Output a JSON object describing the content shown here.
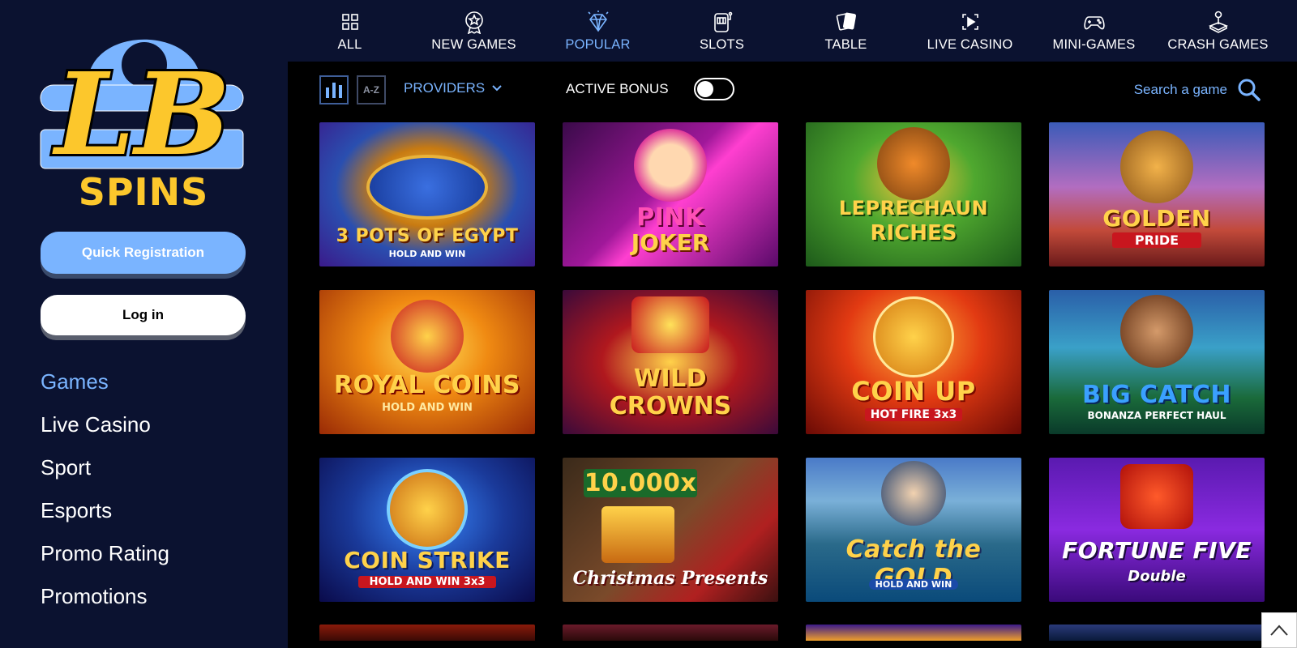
{
  "logo": {
    "initials": "LB",
    "wordmark": "SPINS"
  },
  "sidebar": {
    "register_label": "Quick Registration",
    "login_label": "Log in",
    "nav": [
      {
        "label": "Games",
        "active": true
      },
      {
        "label": "Live Casino"
      },
      {
        "label": "Sport"
      },
      {
        "label": "Esports"
      },
      {
        "label": "Promo Rating"
      },
      {
        "label": "Promotions"
      }
    ]
  },
  "categories": [
    {
      "label": "ALL",
      "icon": "grid-icon"
    },
    {
      "label": "NEW GAMES",
      "icon": "badge-star-icon"
    },
    {
      "label": "POPULAR",
      "icon": "diamond-icon",
      "active": true
    },
    {
      "label": "SLOTS",
      "icon": "slot-machine-icon"
    },
    {
      "label": "TABLE",
      "icon": "playing-cards-icon"
    },
    {
      "label": "LIVE CASINO",
      "icon": "live-video-icon"
    },
    {
      "label": "MINI-GAMES",
      "icon": "gamepad-icon"
    },
    {
      "label": "CRASH GAMES",
      "icon": "joystick-icon"
    }
  ],
  "toolbar": {
    "az_label": "A-Z",
    "providers_label": "PROVIDERS",
    "active_bonus_label": "ACTIVE BONUS",
    "active_bonus_on": false,
    "search_placeholder": "Search a game"
  },
  "games": [
    {
      "line1": "3 POTS OF EGYPT",
      "line2": "HOLD AND WIN"
    },
    {
      "line1": "PINK",
      "line2": "JOKER"
    },
    {
      "line1": "LEPRECHAUN",
      "line2": "RICHES"
    },
    {
      "line1": "GOLDEN",
      "line2": "PRIDE"
    },
    {
      "line1": "ROYAL COINS",
      "line2": "HOLD AND WIN"
    },
    {
      "line1": "WILD",
      "line2": "CROWNS"
    },
    {
      "line1": "COIN UP",
      "line2": "HOT FIRE 3x3"
    },
    {
      "line1": "BIG CATCH",
      "line2": "BONANZA PERFECT HAUL"
    },
    {
      "line1": "COIN STRIKE",
      "line2": "HOLD AND WIN 3x3"
    },
    {
      "line1": "10.000x",
      "line2": "Christmas Presents"
    },
    {
      "line1": "Catch the GOLD",
      "line2": "HOLD AND WIN"
    },
    {
      "line1": "FORTUNE FIVE",
      "line2": "Double"
    }
  ],
  "colors": {
    "sidebar_bg": "#0b1230",
    "accent": "#7ab4ff",
    "brand_yellow": "#fcc72c"
  }
}
